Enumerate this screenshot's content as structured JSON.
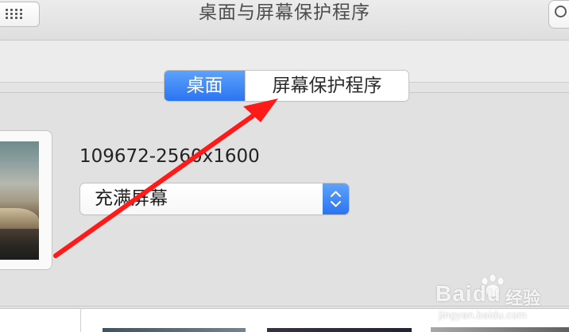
{
  "window": {
    "title": "桌面与屏幕保护程序"
  },
  "toolbar": {
    "grid_icon": "grid-icon",
    "search_icon": "search-icon"
  },
  "tabs": [
    {
      "label": "桌面",
      "active": true
    },
    {
      "label": "屏幕保护程序",
      "active": false
    }
  ],
  "desktop": {
    "wallpaper_name": "109672-2560x1600",
    "fit_option": "充满屏幕"
  },
  "annotation": {
    "arrow_color": "#ff1a1a"
  },
  "watermark": {
    "brand": "Baidu",
    "cn": "经验",
    "url": "jingyan.baidu.com"
  },
  "colors": {
    "accent": "#2a74f2",
    "window_bg": "#e4e4e4"
  }
}
